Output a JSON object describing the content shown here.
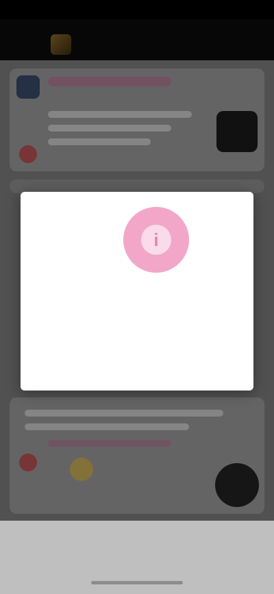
{
  "status_bar": {
    "time": "",
    "icons": ""
  },
  "header": {
    "title": ""
  },
  "modal": {
    "icon": "info-icon",
    "title": "",
    "message": "",
    "action_label": ""
  },
  "bottom_bar": {
    "link_label": ""
  },
  "colors": {
    "accent": "#e06aa3",
    "modal_icon_bg": "#f2a7c8",
    "status_bar_bg": "#000000"
  }
}
